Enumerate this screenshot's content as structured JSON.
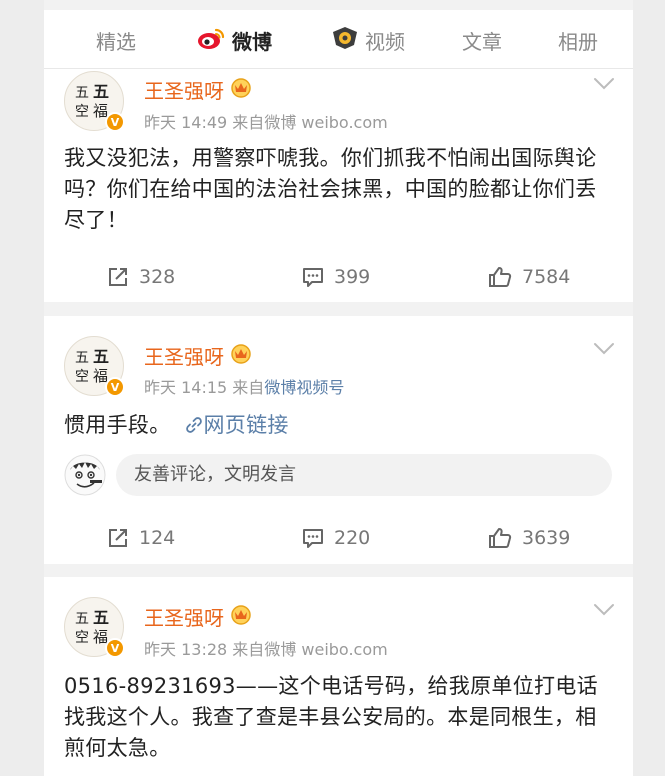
{
  "tabs": [
    {
      "label": "精选",
      "active": false
    },
    {
      "label": "微博",
      "active": true
    },
    {
      "label": "视频",
      "active": false
    },
    {
      "label": "文章",
      "active": false
    },
    {
      "label": "相册",
      "active": false
    }
  ],
  "posts": [
    {
      "author": "王圣强呀",
      "time": "昨天 14:49",
      "source_prefix": "来自",
      "source": "微博 weibo.com",
      "text": "我又没犯法，用警察吓唬我。你们抓我不怕闹出国际舆论吗？你们在给中国的法治社会抹黑，中国的脸都让你们丢尽了！",
      "reposts": "328",
      "comments": "399",
      "likes": "7584"
    },
    {
      "author": "王圣强呀",
      "time": "昨天 14:15",
      "source_prefix": "来自",
      "source": "微博视频号",
      "text": "惯用手段。",
      "link_text": "网页链接",
      "comment_placeholder": "友善评论，文明发言",
      "reposts": "124",
      "comments": "220",
      "likes": "3639"
    },
    {
      "author": "王圣强呀",
      "time": "昨天 13:28",
      "source_prefix": "来自",
      "source": "微博 weibo.com",
      "text": "0516-89231693——这个电话号码，给我原单位打电话找我这个人。我查了查是丰县公安局的。本是同根生，相煎何太急。"
    }
  ],
  "avatar_text": {
    "line1": "五",
    "line2": "空",
    "line3": "福"
  },
  "colors": {
    "author": "#e8661c",
    "link": "#5b7fa8",
    "meta": "#9a9a9a",
    "weibo_red": "#e6162d",
    "page_bg": "#f2f2f2"
  },
  "icons": {
    "weibo_tab": "weibo-logo-icon",
    "video_tab": "video-channel-icon",
    "repost": "repost-icon",
    "comment": "comment-icon",
    "like": "thumbs-up-icon",
    "menu": "chevron-down-icon",
    "link": "link-icon",
    "vip": "vip-crown-icon"
  }
}
